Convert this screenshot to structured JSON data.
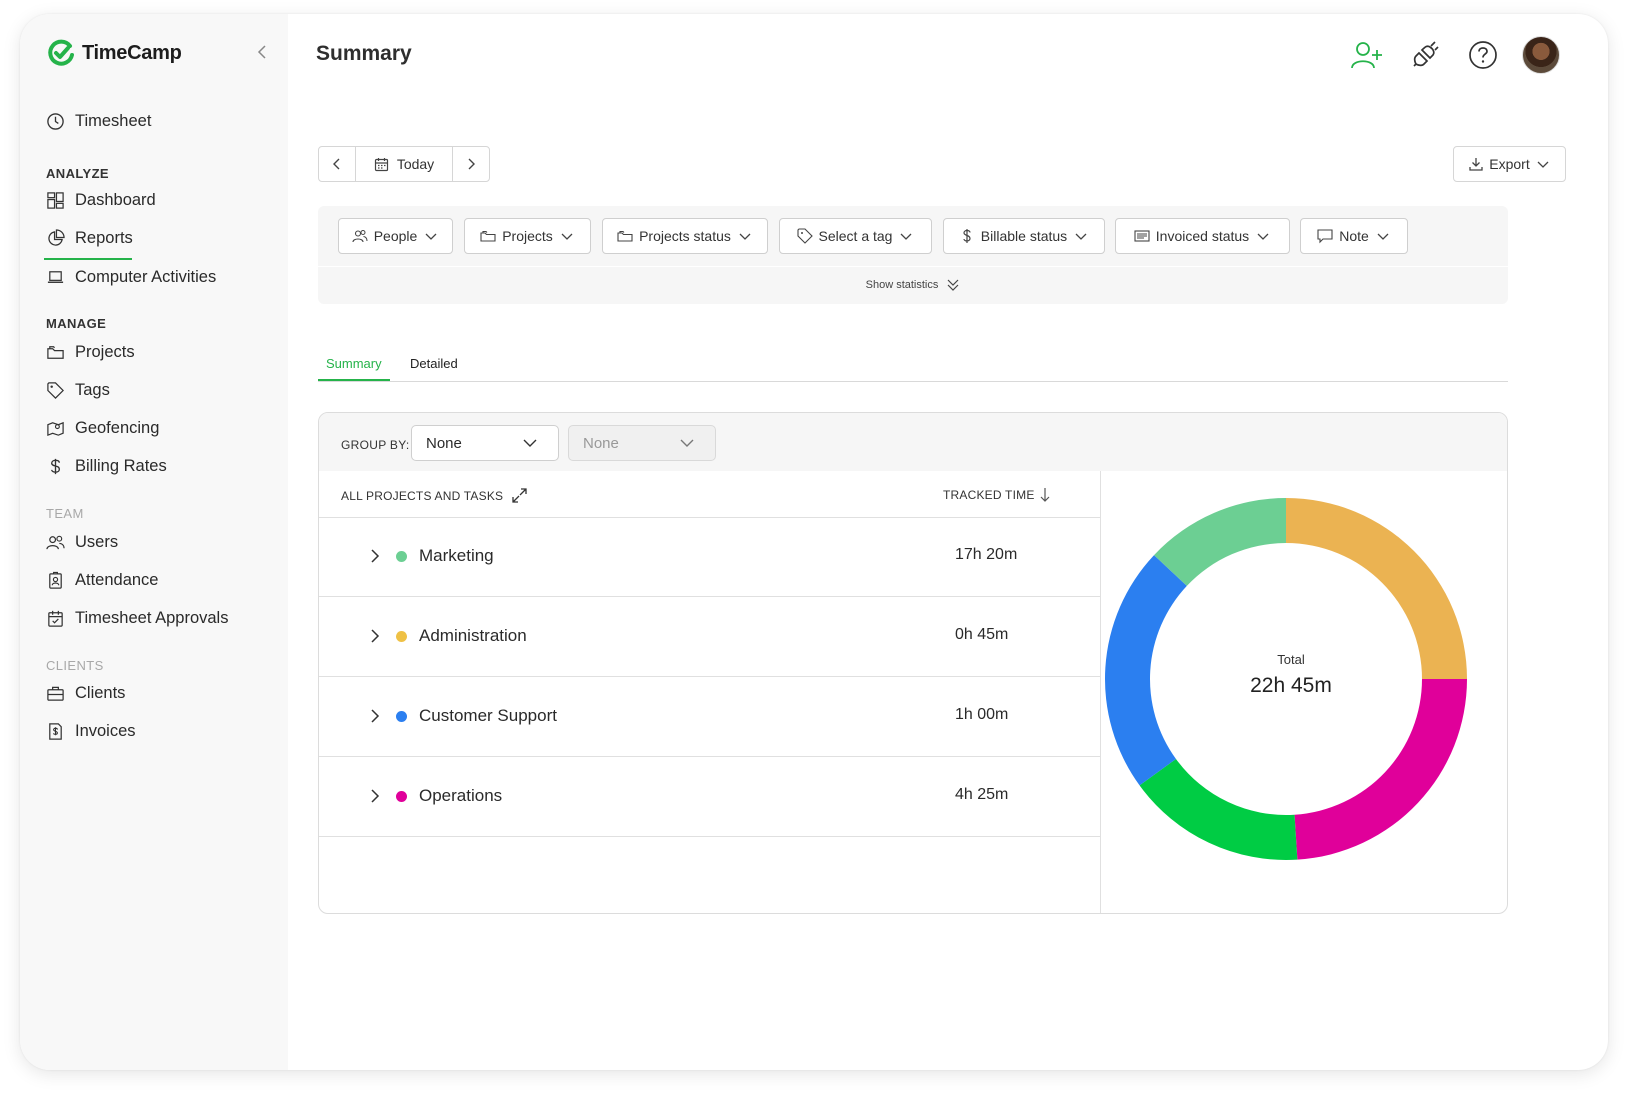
{
  "app": {
    "name": "TimeCamp",
    "brand_color": "#25b34a"
  },
  "sidebar": {
    "top_item": {
      "label": "Timesheet",
      "icon": "clock-icon"
    },
    "sections": [
      {
        "title": "ANALYZE",
        "items": [
          {
            "label": "Dashboard",
            "icon": "dashboard-icon"
          },
          {
            "label": "Reports",
            "icon": "pie-chart-icon",
            "active": true
          },
          {
            "label": "Computer Activities",
            "icon": "laptop-icon"
          }
        ]
      },
      {
        "title": "MANAGE",
        "items": [
          {
            "label": "Projects",
            "icon": "folder-icon"
          },
          {
            "label": "Tags",
            "icon": "tag-icon"
          },
          {
            "label": "Geofencing",
            "icon": "map-icon"
          },
          {
            "label": "Billing Rates",
            "icon": "dollar-icon"
          }
        ]
      },
      {
        "title": "TEAM",
        "items": [
          {
            "label": "Users",
            "icon": "users-icon"
          },
          {
            "label": "Attendance",
            "icon": "badge-icon"
          },
          {
            "label": "Timesheet Approvals",
            "icon": "calendar-check-icon"
          }
        ]
      },
      {
        "title": "CLIENTS",
        "items": [
          {
            "label": "Clients",
            "icon": "briefcase-icon"
          },
          {
            "label": "Invoices",
            "icon": "invoice-icon"
          }
        ]
      }
    ]
  },
  "header": {
    "title": "Summary"
  },
  "date_nav": {
    "today_label": "Today"
  },
  "export": {
    "label": "Export"
  },
  "filters": {
    "people": "People",
    "projects": "Projects",
    "projects_status": "Projects status",
    "tag": "Select a tag",
    "billable": "Billable status",
    "invoiced": "Invoiced status",
    "note": "Note",
    "show_statistics": "Show statistics"
  },
  "tabs": {
    "summary": "Summary",
    "detailed": "Detailed"
  },
  "group_by": {
    "label": "GROUP BY:",
    "primary": "None",
    "secondary": "None"
  },
  "table": {
    "col_projects": "ALL PROJECTS AND TASKS",
    "col_time": "TRACKED TIME",
    "rows": [
      {
        "name": "Marketing",
        "time": "17h 20m",
        "color": "#6ccf93"
      },
      {
        "name": "Administration",
        "time": "0h 45m",
        "color": "#efc145"
      },
      {
        "name": "Customer Support",
        "time": "1h 00m",
        "color": "#2b7ff0"
      },
      {
        "name": "Operations",
        "time": "4h 25m",
        "color": "#e0009a"
      }
    ]
  },
  "chart_data": {
    "type": "pie",
    "title": "",
    "center_label": "Total",
    "center_value": "22h 45m",
    "slices": [
      {
        "value": 25,
        "color": "#ebb352"
      },
      {
        "value": 24,
        "color": "#e0009a"
      },
      {
        "value": 16,
        "color": "#00cc44"
      },
      {
        "value": 22,
        "color": "#2b7ff0"
      },
      {
        "value": 13,
        "color": "#6ccf93"
      }
    ]
  }
}
